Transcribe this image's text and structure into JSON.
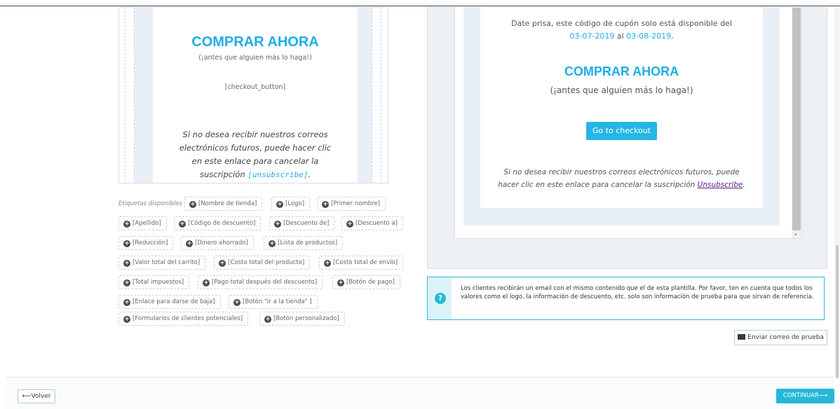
{
  "left_template": {
    "title": "COMPRAR AHORA",
    "subtitle": "(¡antes que alguien más lo haga!)",
    "checkout_tag": "[checkout_button]",
    "unsubscribe_text": "Si no desea recibir nuestros correos electrónicos futuros, puede hacer clic en este enlace para cancelar la suscripción",
    "unsubscribe_tag": "[unsubscribe]",
    "unsubscribe_end": "."
  },
  "tags": {
    "label": "Etiquetas disponibles :",
    "items": [
      "[Nombre de tienda]",
      "[Logo]",
      "[Primer nombre]",
      "[Apellido]",
      "[Código de descuento]",
      "[Descuento de]",
      "[Descuento a]",
      "[Reducción]",
      "[Dinero ahorrado]",
      "[Lista de productos]",
      "[Valor total del carrito]",
      "[Costo total del producto]",
      "[Costo total de envío]",
      "[Total impuestos]",
      "[Pago total después del descuento]",
      "[Botón de pago]",
      "[Enlace para darse de baja]",
      "[Botón \"Ir a la tienda\" ]",
      "[Formularios de clientes potenciales]",
      "[Botón personalizado]"
    ]
  },
  "preview": {
    "date_line1": "Date prisa, este código de cupón solo está disponible del",
    "date_from": "03-07-2019",
    "date_join": " al ",
    "date_to": "03-08-2019",
    "date_end": ".",
    "title": "COMPRAR AHORA",
    "subtitle": "(¡antes que alguien más lo haga!)",
    "checkout_button": "Go to checkout",
    "unsub_line1": "Si no desea recibir nuestros correos electrónicos futuros, puede",
    "unsub_line2": "hacer clic en este enlace para cancelar la suscripción",
    "unsub_link": "Unsubscribe",
    "unsub_end": "."
  },
  "info": {
    "icon": "question-circle-icon",
    "text": "Los clientes recibirán un email con el mismo contenido que el de esta plantilla. Por favor, ten en cuenta que todos los valores como el logo, la información de descuento, etc. solo son información de prueba para que sirvan de referencia."
  },
  "actions": {
    "send_test": "Enviar correo de prueba",
    "back": "Volver",
    "continue": "CONTINUAR"
  },
  "colors": {
    "accent": "#1eaee6",
    "primary_button": "#25b9d7",
    "link_visited": "#5a1a8c"
  }
}
